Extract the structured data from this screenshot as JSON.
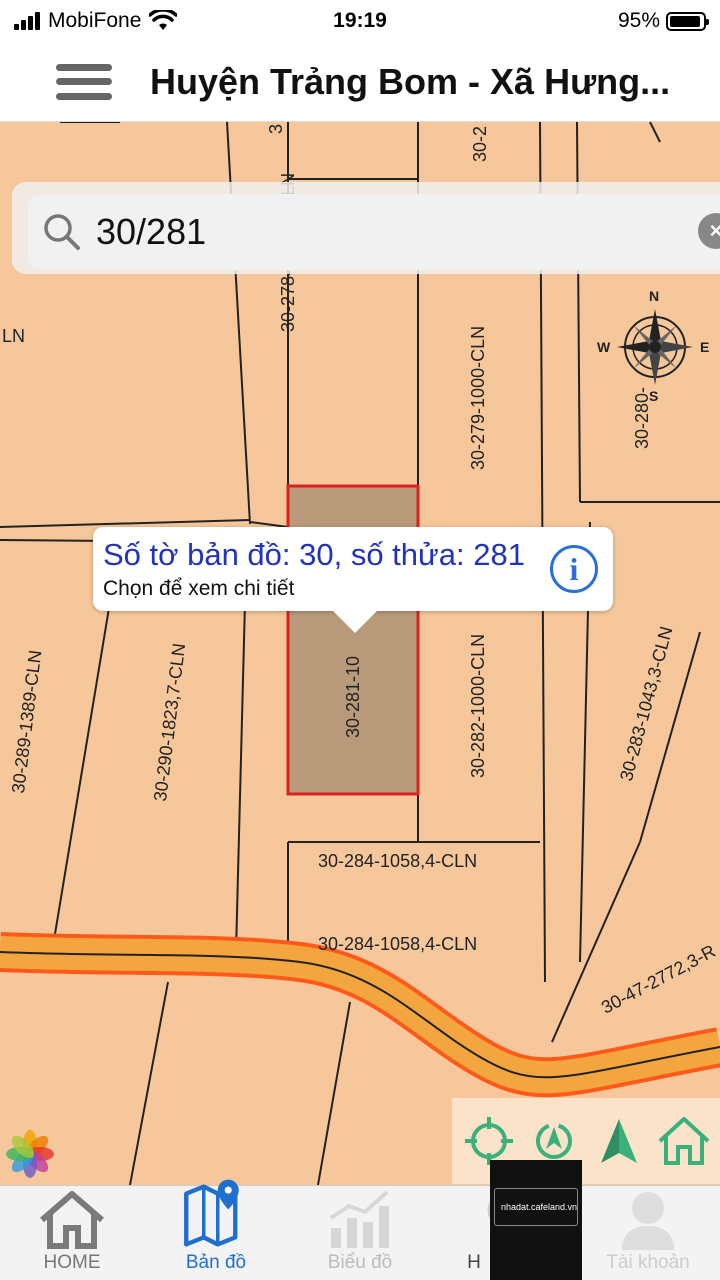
{
  "status_bar": {
    "carrier": "MobiFone",
    "time": "19:19",
    "battery_pct_text": "95%",
    "battery_level": 0.95
  },
  "header": {
    "title": "Huyện Trảng Bom - Xã Hưng..."
  },
  "search": {
    "value": "30/281",
    "placeholder": ""
  },
  "callout": {
    "title": "Số tờ bản đồ: 30, số thửa: 281",
    "subtitle": "Chọn để xem chi tiết"
  },
  "map": {
    "parcel_labels": {
      "p278": "30-278-1053,9-CLN",
      "p279": "30-279-1000-CLN",
      "p280": "30-280-",
      "p281": "30-281-10",
      "p282": "30-282-1000-CLN",
      "p283": "30-283-1043,3-CLN",
      "p284a": "30-284-1058,4-CLN",
      "p284b": "30-284-1058,4-CLN",
      "p289": "30-289-1389-CLN",
      "p290": "30-290-1823,7-CLN",
      "p47": "30-47-2772,3-R",
      "cln_left": "LN",
      "top1": "3",
      "top2": "30-2"
    },
    "compass": {
      "n": "N",
      "s": "S",
      "e": "E",
      "w": "W"
    },
    "colors": {
      "land": "#f5c79a",
      "selected_parcel": "#b89a7a",
      "selected_border": "#e02020",
      "road": "#f3a640",
      "road_border": "#ff5a1a",
      "tool_green": "#3ab07a"
    }
  },
  "watermark": {
    "text": "nhadat.cafeland.vn"
  },
  "tabs": [
    {
      "label": "HOME",
      "icon": "home-icon"
    },
    {
      "label": "Bản đồ",
      "icon": "map-icon"
    },
    {
      "label": "Biểu đồ",
      "icon": "chart-icon"
    },
    {
      "label": "H",
      "icon": "help-icon"
    },
    {
      "label": "Tài khoản",
      "icon": "account-icon"
    }
  ]
}
